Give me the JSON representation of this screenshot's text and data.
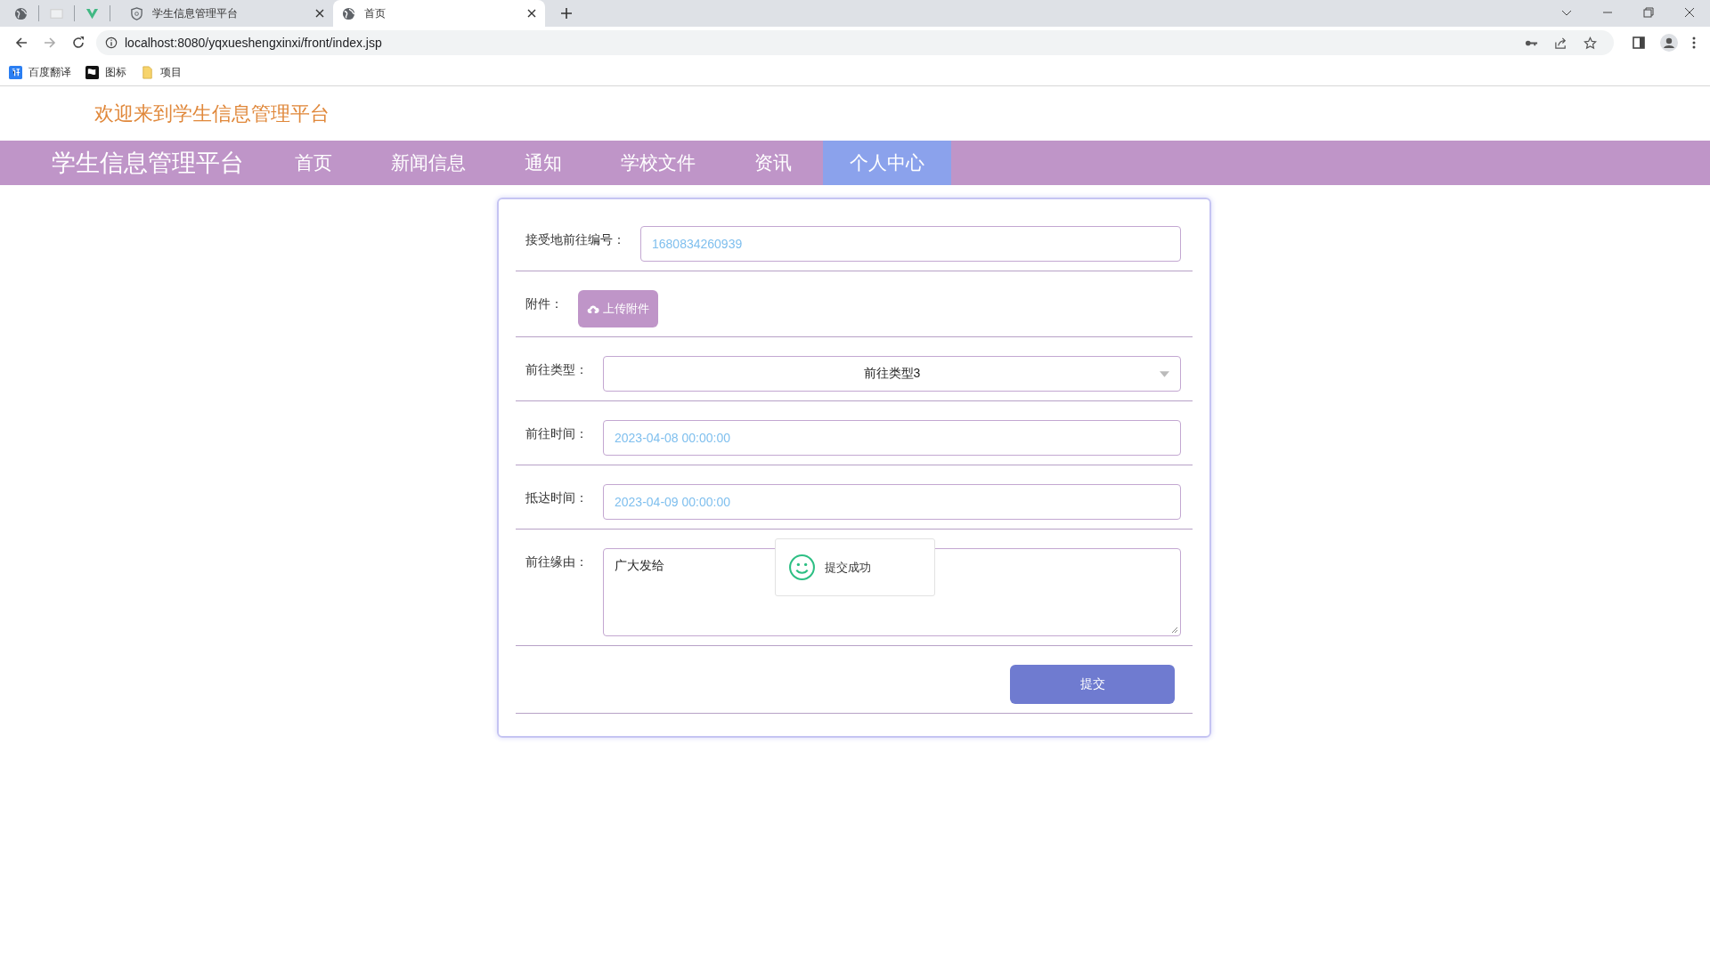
{
  "browser": {
    "tabs": [
      {
        "title": "学生信息管理平台",
        "selected": false
      },
      {
        "title": "首页",
        "selected": true
      }
    ],
    "url": "localhost:8080/yqxueshengxinxi/front/index.jsp",
    "bookmarks": [
      {
        "label": "百度翻译",
        "kind": "translate"
      },
      {
        "label": "图标",
        "kind": "flag"
      },
      {
        "label": "项目",
        "kind": "folder"
      }
    ]
  },
  "site": {
    "welcome": "欢迎来到学生信息管理平台",
    "logo": "学生信息管理平台",
    "nav": [
      {
        "label": "首页",
        "selected": false
      },
      {
        "label": "新闻信息",
        "selected": false
      },
      {
        "label": "通知",
        "selected": false
      },
      {
        "label": "学校文件",
        "selected": false
      },
      {
        "label": "资讯",
        "selected": false
      },
      {
        "label": "个人中心",
        "selected": true
      }
    ]
  },
  "form": {
    "fields": [
      {
        "kind": "readonly",
        "label": "接受地前往编号：",
        "value": "1680834260939"
      },
      {
        "kind": "upload",
        "label": "附件：",
        "button": "上传附件"
      },
      {
        "kind": "select",
        "label": "前往类型：",
        "value": "前往类型3"
      },
      {
        "kind": "readonly",
        "label": "前往时间：",
        "value": "2023-04-08 00:00:00"
      },
      {
        "kind": "readonly",
        "label": "抵达时间：",
        "value": "2023-04-09 00:00:00"
      },
      {
        "kind": "textarea",
        "label": "前往缘由：",
        "value": "广大发给"
      }
    ],
    "submit": "提交"
  },
  "toast": {
    "message": "提交成功"
  }
}
